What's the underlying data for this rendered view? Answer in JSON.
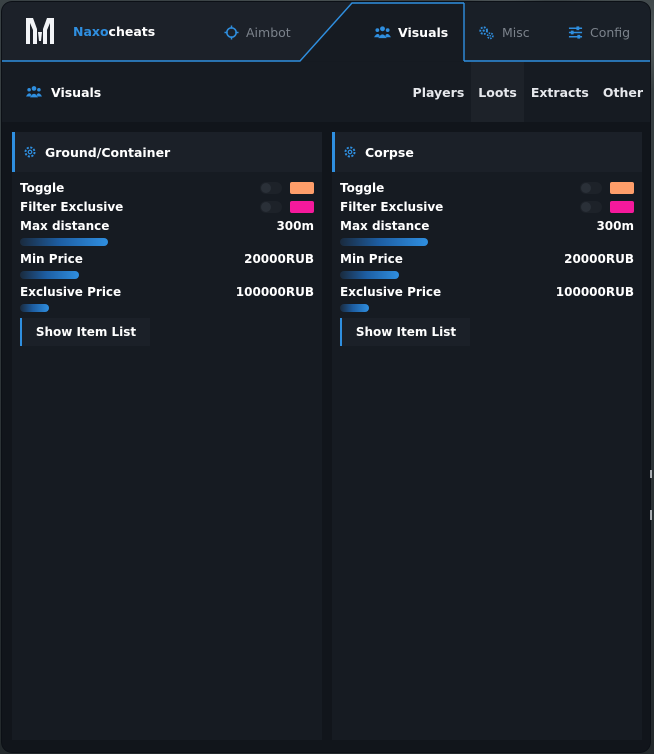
{
  "brand": {
    "prefix": "Naxo",
    "suffix": "cheats"
  },
  "nav": {
    "tabs": [
      {
        "label": "Aimbot",
        "icon": "crosshair-icon",
        "active": false
      },
      {
        "label": "Visuals",
        "icon": "users-icon",
        "active": true
      },
      {
        "label": "Misc",
        "icon": "gears-icon",
        "active": false
      },
      {
        "label": "Config",
        "icon": "sliders-icon",
        "active": false
      }
    ]
  },
  "subbar": {
    "title": "Visuals",
    "icon": "users-icon",
    "tabs": [
      {
        "label": "Players",
        "active": false
      },
      {
        "label": "Loots",
        "active": true
      },
      {
        "label": "Extracts",
        "active": false
      },
      {
        "label": "Other",
        "active": false
      }
    ]
  },
  "panels": [
    {
      "title": "Ground/Container",
      "icon": "gear-icon",
      "toggle": {
        "label": "Toggle",
        "enabled": false,
        "color": "#ff9e6a"
      },
      "filter_exclusive": {
        "label": "Filter Exclusive",
        "enabled": false,
        "color": "#f5199c"
      },
      "max_distance": {
        "label": "Max distance",
        "value": "300m",
        "fraction": 0.3
      },
      "min_price": {
        "label": "Min Price",
        "value": "20000RUB",
        "fraction": 0.2
      },
      "exclusive_price": {
        "label": "Exclusive Price",
        "value": "100000RUB",
        "fraction": 0.1
      },
      "button": {
        "label": "Show Item List"
      }
    },
    {
      "title": "Corpse",
      "icon": "gear-icon",
      "toggle": {
        "label": "Toggle",
        "enabled": false,
        "color": "#ff9e6a"
      },
      "filter_exclusive": {
        "label": "Filter Exclusive",
        "enabled": false,
        "color": "#f5199c"
      },
      "max_distance": {
        "label": "Max distance",
        "value": "300m",
        "fraction": 0.3
      },
      "min_price": {
        "label": "Min Price",
        "value": "20000RUB",
        "fraction": 0.2
      },
      "exclusive_price": {
        "label": "Exclusive Price",
        "value": "100000RUB",
        "fraction": 0.1
      },
      "button": {
        "label": "Show Item List"
      }
    }
  ],
  "colors": {
    "accent": "#2f8fe0",
    "window_bg": "#151a21",
    "panel_bg": "#161b22"
  }
}
